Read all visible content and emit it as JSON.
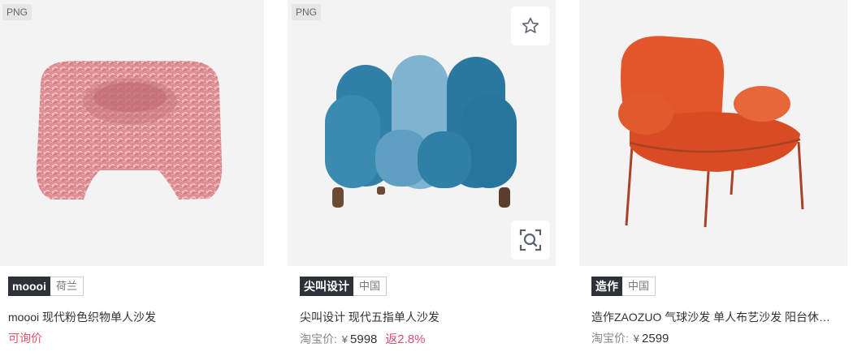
{
  "colors": {
    "accent_pink": "#e0506b",
    "brand_tag_bg": "#2e3138",
    "card_bg": "#f3f3f3"
  },
  "products": [
    {
      "badge": "PNG",
      "brand": "moooi",
      "origin": "荷兰",
      "title": "moooi 现代粉色织物单人沙发",
      "inquiry": "可询价",
      "image_icon": "pink-ruffle-armchair"
    },
    {
      "badge": "PNG",
      "brand": "尖叫设计",
      "origin": "中国",
      "title": "尖叫设计 现代五指单人沙发",
      "price_label": "淘宝价:",
      "currency": "¥",
      "price": "5998",
      "rebate": "返2.8%",
      "image_icon": "blue-five-finger-armchair",
      "actions": {
        "favorite_icon": "star-icon",
        "search_icon": "image-search-icon"
      }
    },
    {
      "brand": "造作",
      "origin": "中国",
      "title": "造作ZAOZUO 气球沙发 单人布艺沙发 阳台休闲椅",
      "price_label": "淘宝价:",
      "currency": "¥",
      "price": "2599",
      "image_icon": "orange-balloon-armchair"
    }
  ]
}
